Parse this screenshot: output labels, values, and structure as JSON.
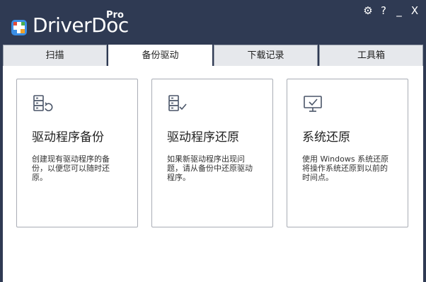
{
  "app": {
    "logo_text": "DriverDoc",
    "logo_edition": "Pro"
  },
  "window_controls": {
    "settings": "⚙",
    "help": "?",
    "minimize": "_",
    "close": "X"
  },
  "tabs": [
    {
      "label": "扫描",
      "active": false
    },
    {
      "label": "备份驱动",
      "active": true
    },
    {
      "label": "下载记录",
      "active": false
    },
    {
      "label": "工具箱",
      "active": false
    }
  ],
  "cards": [
    {
      "icon": "server-restore-icon",
      "title": "驱动程序备份",
      "description": "创建现有驱动程序的备份，以便您可以随时还原。"
    },
    {
      "icon": "checklist-icon",
      "title": "驱动程序还原",
      "description": "如果新驱动程序出现问题，请从备份中还原驱动程序。"
    },
    {
      "icon": "monitor-check-icon",
      "title": "系统还原",
      "description": "使用 Windows 系统还原将操作系统还原到以前的时间点。"
    }
  ],
  "colors": {
    "titlebar_bg": "#2f3a53",
    "tab_bg": "#e6e8ec",
    "card_border": "#a9adb5",
    "icon_stroke": "#4a5568",
    "logo_cross_bg": "#3a8ee6",
    "logo_cross_accent": "#f2a22a"
  }
}
